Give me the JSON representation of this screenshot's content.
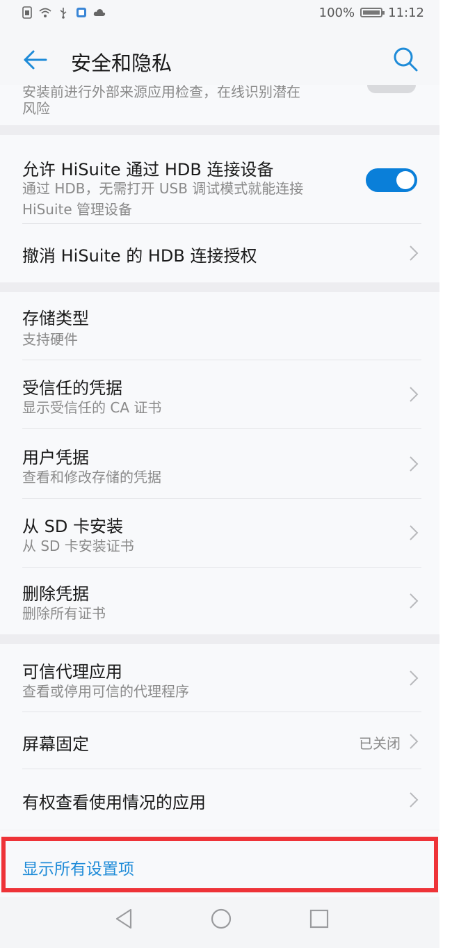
{
  "status_bar": {
    "battery_percent": "100%",
    "time": "11:12",
    "left_icons": [
      "sim-card-icon",
      "wifi-icon",
      "usb-icon",
      "app-notification-icon",
      "cloud-icon"
    ]
  },
  "header": {
    "title": "安全和隐私",
    "back_icon": "arrow-left-icon",
    "search_icon": "search-icon"
  },
  "cut_item": {
    "subtitle_line1_partial": "安装前进行外部来源应用检查，在线识别潜在",
    "subtitle_line2": "风险"
  },
  "settings": {
    "hdb_allow": {
      "title": "允许 HiSuite 通过 HDB 连接设备",
      "subtitle_line1": "通过 HDB，无需打开 USB 调试模式就能连接",
      "subtitle_line2": "HiSuite 管理设备",
      "enabled": true
    },
    "hdb_revoke": {
      "title": "撤消 HiSuite 的 HDB 连接授权"
    },
    "storage_type": {
      "title": "存储类型",
      "subtitle": "支持硬件"
    },
    "trusted_credentials": {
      "title": "受信任的凭据",
      "subtitle": "显示受信任的 CA 证书"
    },
    "user_credentials": {
      "title": "用户凭据",
      "subtitle": "查看和修改存储的凭据"
    },
    "install_from_sd": {
      "title": "从 SD 卡安装",
      "subtitle": "从 SD 卡安装证书"
    },
    "clear_credentials": {
      "title": "删除凭据",
      "subtitle": "删除所有证书"
    },
    "trust_agents": {
      "title": "可信代理应用",
      "subtitle": "查看或停用可信的代理程序"
    },
    "screen_pinning": {
      "title": "屏幕固定",
      "value": "已关闭"
    },
    "usage_access": {
      "title": "有权查看使用情况的应用"
    }
  },
  "footer": {
    "show_all_label": "显示所有设置项"
  },
  "colors": {
    "accent": "#1e8bd8",
    "toggle_on": "#0a7fd9",
    "highlight": "#ee3338"
  }
}
